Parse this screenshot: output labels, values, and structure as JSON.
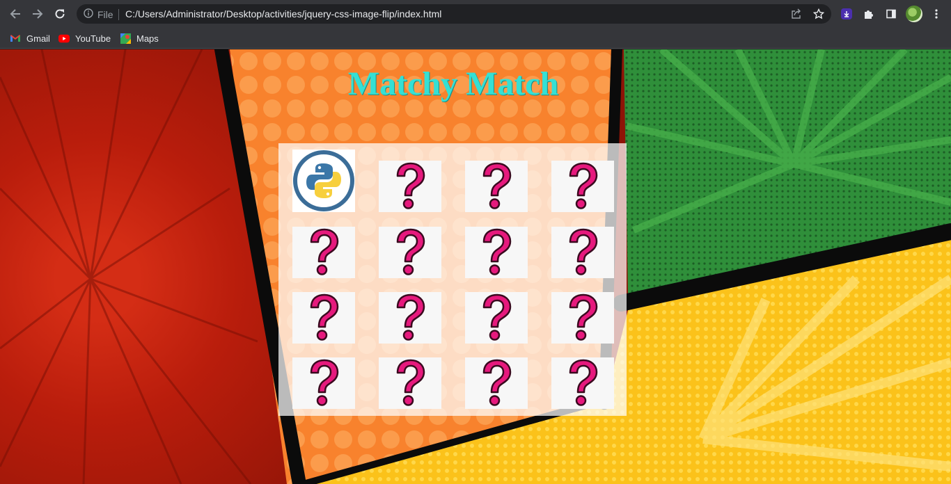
{
  "browser": {
    "site_info_label": "File",
    "url": "C:/Users/Administrator/Desktop/activities/jquery-css-image-flip/index.html",
    "icons": [
      "back-arrow-icon",
      "forward-arrow-icon",
      "reload-icon",
      "info-icon",
      "share-icon",
      "star-icon",
      "download-extension-icon",
      "puzzle-icon",
      "side-panel-icon",
      "profile-avatar",
      "kebab-menu-icon"
    ]
  },
  "bookmarks": [
    {
      "label": "Gmail",
      "icon": "gmail-icon"
    },
    {
      "label": "YouTube",
      "icon": "youtube-icon"
    },
    {
      "label": "Maps",
      "icon": "maps-icon"
    }
  ],
  "page": {
    "title": "Matchy Match",
    "title_color": "#35e0d4"
  },
  "board": {
    "rows": 4,
    "columns": 4,
    "cards": [
      {
        "state": "revealed",
        "image": "python-logo"
      },
      {
        "state": "hidden",
        "image": "question-mark"
      },
      {
        "state": "hidden",
        "image": "question-mark"
      },
      {
        "state": "hidden",
        "image": "question-mark"
      },
      {
        "state": "hidden",
        "image": "question-mark"
      },
      {
        "state": "hidden",
        "image": "question-mark"
      },
      {
        "state": "hidden",
        "image": "question-mark"
      },
      {
        "state": "hidden",
        "image": "question-mark"
      },
      {
        "state": "hidden",
        "image": "question-mark"
      },
      {
        "state": "hidden",
        "image": "question-mark"
      },
      {
        "state": "hidden",
        "image": "question-mark"
      },
      {
        "state": "hidden",
        "image": "question-mark"
      },
      {
        "state": "hidden",
        "image": "question-mark"
      },
      {
        "state": "hidden",
        "image": "question-mark"
      },
      {
        "state": "hidden",
        "image": "question-mark"
      },
      {
        "state": "hidden",
        "image": "question-mark"
      }
    ],
    "question_color": "#e6197d"
  }
}
